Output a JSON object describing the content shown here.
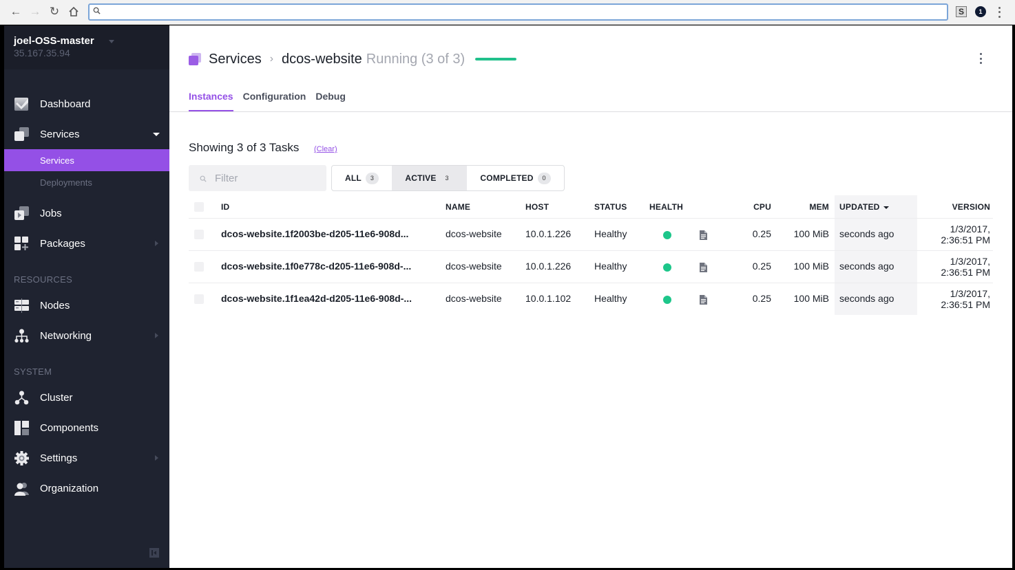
{
  "browser": {
    "url_value": "",
    "nav": {
      "back": "back-icon",
      "forward": "forward-icon",
      "reload": "reload-icon",
      "home": "home-icon"
    },
    "extensions": [
      {
        "name": "s-extension",
        "label": "S"
      },
      {
        "name": "badge-extension",
        "label": "1"
      }
    ]
  },
  "sidebar": {
    "cluster_name": "joel-OSS-master",
    "cluster_ip": "35.167.35.94",
    "items": [
      {
        "label": "Dashboard",
        "icon": "dashboard-icon"
      },
      {
        "label": "Services",
        "icon": "services-icon",
        "expanded": true,
        "children": [
          {
            "label": "Services",
            "active": true
          },
          {
            "label": "Deployments",
            "active": false
          }
        ]
      },
      {
        "label": "Jobs",
        "icon": "jobs-icon"
      },
      {
        "label": "Packages",
        "icon": "packages-icon",
        "has_submenu": true
      }
    ],
    "sections": [
      {
        "heading": "RESOURCES",
        "items": [
          {
            "label": "Nodes",
            "icon": "nodes-icon"
          },
          {
            "label": "Networking",
            "icon": "networking-icon",
            "has_submenu": true
          }
        ]
      },
      {
        "heading": "SYSTEM",
        "items": [
          {
            "label": "Cluster",
            "icon": "cluster-icon"
          },
          {
            "label": "Components",
            "icon": "components-icon"
          },
          {
            "label": "Settings",
            "icon": "settings-icon",
            "has_submenu": true
          },
          {
            "label": "Organization",
            "icon": "organization-icon"
          }
        ]
      }
    ]
  },
  "header": {
    "breadcrumb_root": "Services",
    "breadcrumb_separator": "›",
    "service_name": "dcos-website",
    "status": "Running (3 of 3)",
    "running_fraction": 1.0,
    "status_color": "#21c08b"
  },
  "tabs": [
    {
      "label": "Instances",
      "active": true
    },
    {
      "label": "Configuration",
      "active": false
    },
    {
      "label": "Debug",
      "active": false
    }
  ],
  "tasks": {
    "showing_text": "Showing 3 of 3 Tasks",
    "clear_label": "(Clear)",
    "filter_placeholder": "Filter",
    "filter_value": "",
    "segments": [
      {
        "label": "ALL",
        "count": "3",
        "active": false
      },
      {
        "label": "ACTIVE",
        "count": "3",
        "active": true
      },
      {
        "label": "COMPLETED",
        "count": "0",
        "active": false
      }
    ],
    "columns": [
      "ID",
      "NAME",
      "HOST",
      "STATUS",
      "HEALTH",
      "CPU",
      "MEM",
      "UPDATED",
      "VERSION"
    ],
    "sorted_column": "UPDATED",
    "rows": [
      {
        "id": "dcos-website.1f2003be-d205-11e6-908d...",
        "name": "dcos-website",
        "host": "10.0.1.226",
        "status": "Healthy",
        "health": "healthy",
        "cpu": "0.25",
        "mem": "100 MiB",
        "updated": "seconds ago",
        "version_date": "1/3/2017,",
        "version_time": "2:36:51 PM"
      },
      {
        "id": "dcos-website.1f0e778c-d205-11e6-908d-...",
        "name": "dcos-website",
        "host": "10.0.1.226",
        "status": "Healthy",
        "health": "healthy",
        "cpu": "0.25",
        "mem": "100 MiB",
        "updated": "seconds ago",
        "version_date": "1/3/2017,",
        "version_time": "2:36:51 PM"
      },
      {
        "id": "dcos-website.1f1ea42d-d205-11e6-908d-...",
        "name": "dcos-website",
        "host": "10.0.1.102",
        "status": "Healthy",
        "health": "healthy",
        "cpu": "0.25",
        "mem": "100 MiB",
        "updated": "seconds ago",
        "version_date": "1/3/2017,",
        "version_time": "2:36:51 PM"
      }
    ]
  },
  "colors": {
    "accent": "#9450e6",
    "sidebar_bg": "#1f2330",
    "healthy": "#1dc68a"
  }
}
